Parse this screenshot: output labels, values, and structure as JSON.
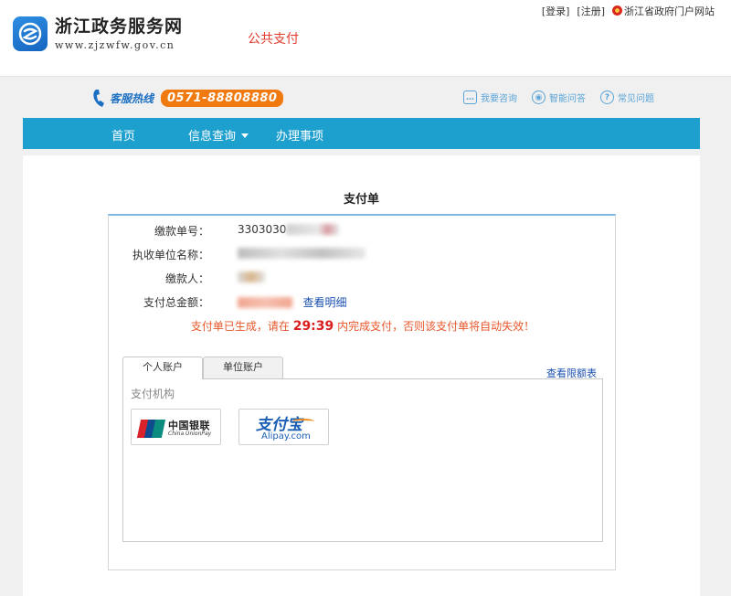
{
  "header": {
    "site_title": "浙江政务服务网",
    "site_url": "www.zjzwfw.gov.cn",
    "section_name": "公共支付",
    "links": {
      "login": "[登录]",
      "register": "[注册]",
      "portal": "浙江省政府门户网站"
    }
  },
  "hotline": {
    "label": "客服热线",
    "number": "0571-88808880"
  },
  "quick_links": [
    {
      "label": "我要咨询",
      "icon": "chat-icon"
    },
    {
      "label": "智能问答",
      "icon": "robot-icon"
    },
    {
      "label": "常见问题",
      "icon": "question-icon"
    }
  ],
  "nav": {
    "home": "首页",
    "info_query": "信息查询",
    "services": "办理事项"
  },
  "payment": {
    "title": "支付单",
    "fields": {
      "order_no_label": "缴款单号：",
      "order_no_value": "3303030",
      "unit_label": "执收单位名称：",
      "payer_label": "缴款人：",
      "amount_label": "支付总金额：",
      "detail_link": "查看明细"
    },
    "notice": {
      "prefix": "支付单已生成，请在 ",
      "timer": "29:39",
      "suffix": " 内完成支付，否则该支付单将自动失效！"
    },
    "tabs": {
      "personal": "个人账户",
      "business": "单位账户"
    },
    "limit_link": "查看限额表",
    "org_label": "支付机构",
    "methods": {
      "unionpay_cn": "中国银联",
      "unionpay_en": "China UnionPay",
      "unionpay_badge": "UnionPay 银联",
      "alipay_cn": "支付宝",
      "alipay_en": "Alipay.com"
    }
  },
  "colors": {
    "nav_bg": "#1ea0cf",
    "section_red": "#e23b2d",
    "hotline_orange": "#f07a10",
    "notice_orange": "#e8572b",
    "link_blue": "#1a4fb0"
  }
}
